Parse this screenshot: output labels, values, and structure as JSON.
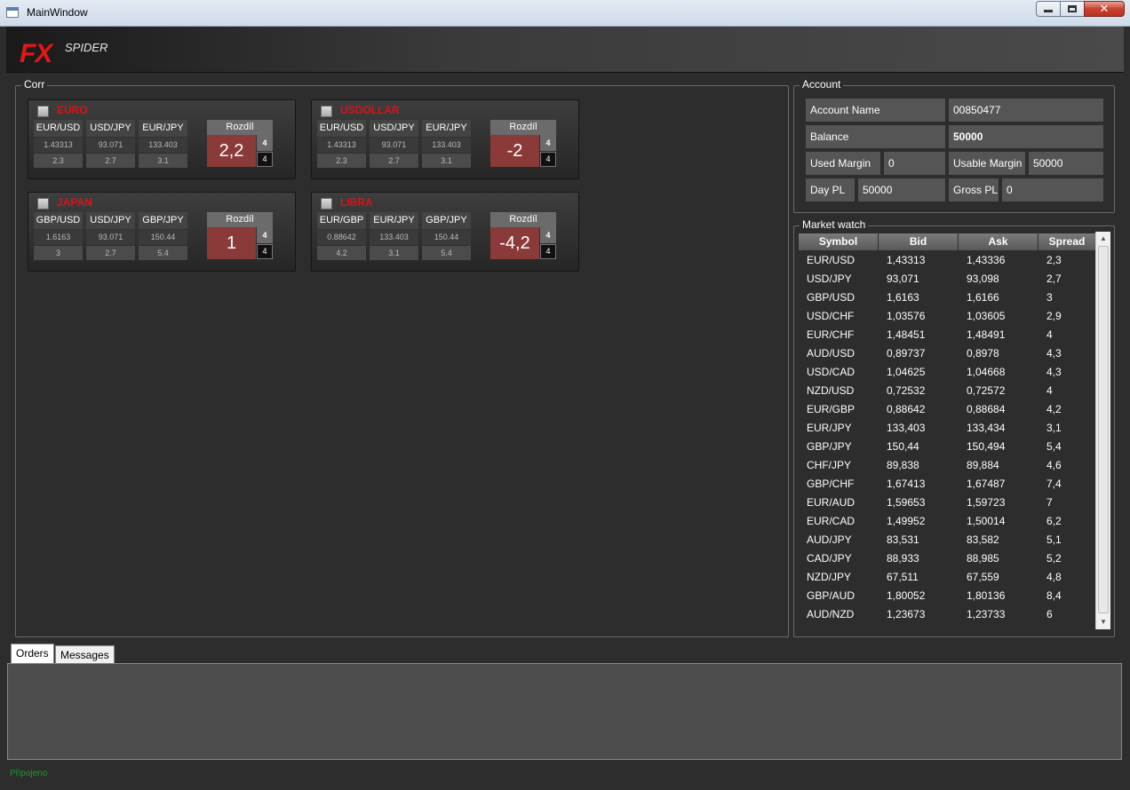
{
  "window": {
    "title": "MainWindow",
    "close_glyph": "✕"
  },
  "logo": {
    "fx": "FX",
    "spider": "SPIDER"
  },
  "corr": {
    "title": "Corr",
    "cards": [
      {
        "name": "EURO",
        "pairs": [
          {
            "symbol": "EUR/USD",
            "price": "1.43313",
            "spread": "2.3"
          },
          {
            "symbol": "USD/JPY",
            "price": "93.071",
            "spread": "2.7"
          },
          {
            "symbol": "EUR/JPY",
            "price": "133.403",
            "spread": "3.1"
          }
        ],
        "rozdil_label": "Rozdíl",
        "rozdil_value": "2,2",
        "n1": "4",
        "n2": "4"
      },
      {
        "name": "USDOLLAR",
        "pairs": [
          {
            "symbol": "EUR/USD",
            "price": "1.43313",
            "spread": "2.3"
          },
          {
            "symbol": "USD/JPY",
            "price": "93.071",
            "spread": "2.7"
          },
          {
            "symbol": "EUR/JPY",
            "price": "133.403",
            "spread": "3.1"
          }
        ],
        "rozdil_label": "Rozdíl",
        "rozdil_value": "-2",
        "n1": "4",
        "n2": "4"
      },
      {
        "name": "JAPAN",
        "pairs": [
          {
            "symbol": "GBP/USD",
            "price": "1.6163",
            "spread": "3"
          },
          {
            "symbol": "USD/JPY",
            "price": "93.071",
            "spread": "2.7"
          },
          {
            "symbol": "GBP/JPY",
            "price": "150.44",
            "spread": "5.4"
          }
        ],
        "rozdil_label": "Rozdíl",
        "rozdil_value": "1",
        "n1": "4",
        "n2": "4"
      },
      {
        "name": "LIBRA",
        "pairs": [
          {
            "symbol": "EUR/GBP",
            "price": "0.88642",
            "spread": "4.2"
          },
          {
            "symbol": "EUR/JPY",
            "price": "133.403",
            "spread": "3.1"
          },
          {
            "symbol": "GBP/JPY",
            "price": "150.44",
            "spread": "5.4"
          }
        ],
        "rozdil_label": "Rozdíl",
        "rozdil_value": "-4,2",
        "n1": "4",
        "n2": "4"
      }
    ]
  },
  "account": {
    "title": "Account",
    "account_name_label": "Account Name",
    "account_name": "00850477",
    "balance_label": "Balance",
    "balance": "50000",
    "used_margin_label": "Used Margin",
    "used_margin": "0",
    "usable_margin_label": "Usable Margin",
    "usable_margin": "50000",
    "day_pl_label": "Day PL",
    "day_pl": "50000",
    "gross_pl_label": "Gross PL",
    "gross_pl": "0"
  },
  "market_watch": {
    "title": "Market watch",
    "columns": [
      "Symbol",
      "Bid",
      "Ask",
      "Spread"
    ],
    "rows": [
      [
        "EUR/USD",
        "1,43313",
        "1,43336",
        "2,3"
      ],
      [
        "USD/JPY",
        "93,071",
        "93,098",
        "2,7"
      ],
      [
        "GBP/USD",
        "1,6163",
        "1,6166",
        "3"
      ],
      [
        "USD/CHF",
        "1,03576",
        "1,03605",
        "2,9"
      ],
      [
        "EUR/CHF",
        "1,48451",
        "1,48491",
        "4"
      ],
      [
        "AUD/USD",
        "0,89737",
        "0,8978",
        "4,3"
      ],
      [
        "USD/CAD",
        "1,04625",
        "1,04668",
        "4,3"
      ],
      [
        "NZD/USD",
        "0,72532",
        "0,72572",
        "4"
      ],
      [
        "EUR/GBP",
        "0,88642",
        "0,88684",
        "4,2"
      ],
      [
        "EUR/JPY",
        "133,403",
        "133,434",
        "3,1"
      ],
      [
        "GBP/JPY",
        "150,44",
        "150,494",
        "5,4"
      ],
      [
        "CHF/JPY",
        "89,838",
        "89,884",
        "4,6"
      ],
      [
        "GBP/CHF",
        "1,67413",
        "1,67487",
        "7,4"
      ],
      [
        "EUR/AUD",
        "1,59653",
        "1,59723",
        "7"
      ],
      [
        "EUR/CAD",
        "1,49952",
        "1,50014",
        "6,2"
      ],
      [
        "AUD/JPY",
        "83,531",
        "83,582",
        "5,1"
      ],
      [
        "CAD/JPY",
        "88,933",
        "88,985",
        "5,2"
      ],
      [
        "NZD/JPY",
        "67,511",
        "67,559",
        "4,8"
      ],
      [
        "GBP/AUD",
        "1,80052",
        "1,80136",
        "8,4"
      ],
      [
        "AUD/NZD",
        "1,23673",
        "1,23733",
        "6"
      ]
    ]
  },
  "tabs": {
    "orders": "Orders",
    "messages": "Messages"
  },
  "status": {
    "text": "Připojeno",
    "color": "#1c9a2a"
  }
}
